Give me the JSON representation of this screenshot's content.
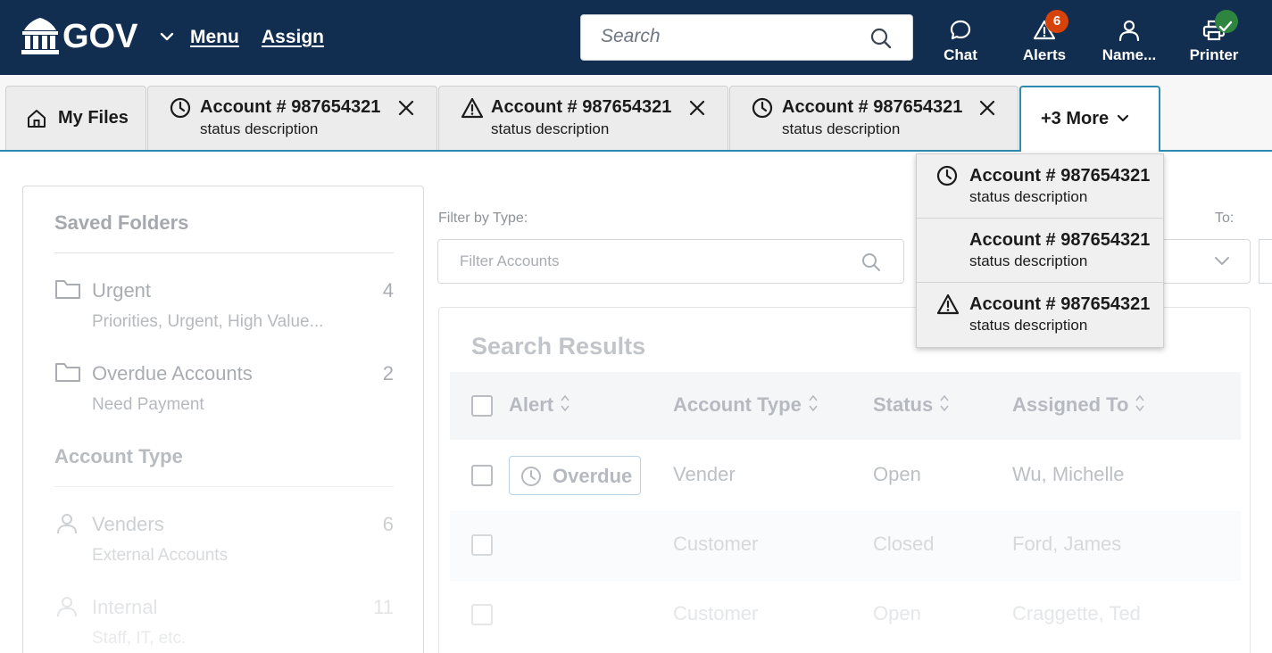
{
  "header": {
    "logo_text": "GOV",
    "menu_label": "Menu",
    "assign_label": "Assign",
    "search_placeholder": "Search",
    "buttons": {
      "chat": "Chat",
      "alerts": "Alerts",
      "alerts_count": "6",
      "name": "Name...",
      "printer": "Printer"
    },
    "colors": {
      "background": "#112e51",
      "alert_badge": "#d54309",
      "printer_badge": "#2e8540"
    }
  },
  "tabs": {
    "home_label": "My Files",
    "items": [
      {
        "title": "Account # 987654321",
        "subtitle": "status description",
        "icon": "clock-icon"
      },
      {
        "title": "Account # 987654321",
        "subtitle": "status description",
        "icon": "warning-icon"
      },
      {
        "title": "Account # 987654321",
        "subtitle": "status description",
        "icon": "clock-icon"
      }
    ],
    "more_label": "+3 More"
  },
  "more_dropdown": {
    "items": [
      {
        "title": "Account # 987654321",
        "subtitle": "status description",
        "icon": "clock-icon"
      },
      {
        "title": "Account # 987654321",
        "subtitle": "status description",
        "icon": ""
      },
      {
        "title": "Account # 987654321",
        "subtitle": "status description",
        "icon": "warning-icon"
      }
    ]
  },
  "sidebar": {
    "saved_folders_title": "Saved Folders",
    "folders": [
      {
        "label": "Urgent",
        "count": "4",
        "description": "Priorities, Urgent, High Value..."
      },
      {
        "label": "Overdue Accounts",
        "count": "2",
        "description": "Need Payment"
      }
    ],
    "account_type_title": "Account Type",
    "account_types": [
      {
        "label": "Venders",
        "count": "6",
        "description": "External Accounts"
      },
      {
        "label": "Internal",
        "count": "11",
        "description": "Staff, IT, etc."
      }
    ]
  },
  "filters": {
    "type_label": "Filter by Type:",
    "filter_placeholder": "Filter Accounts",
    "to_label": "To:"
  },
  "results": {
    "title": "Search Results",
    "columns": [
      "Alert",
      "Account Type",
      "Status",
      "Assigned To"
    ],
    "rows": [
      {
        "alert": "Overdue",
        "account_type": "Vender",
        "status": "Open",
        "assigned_to": "Wu, Michelle"
      },
      {
        "alert": "",
        "account_type": "Customer",
        "status": "Closed",
        "assigned_to": "Ford, James"
      },
      {
        "alert": "",
        "account_type": "Customer",
        "status": "Open",
        "assigned_to": "Craggette, Ted"
      }
    ]
  }
}
